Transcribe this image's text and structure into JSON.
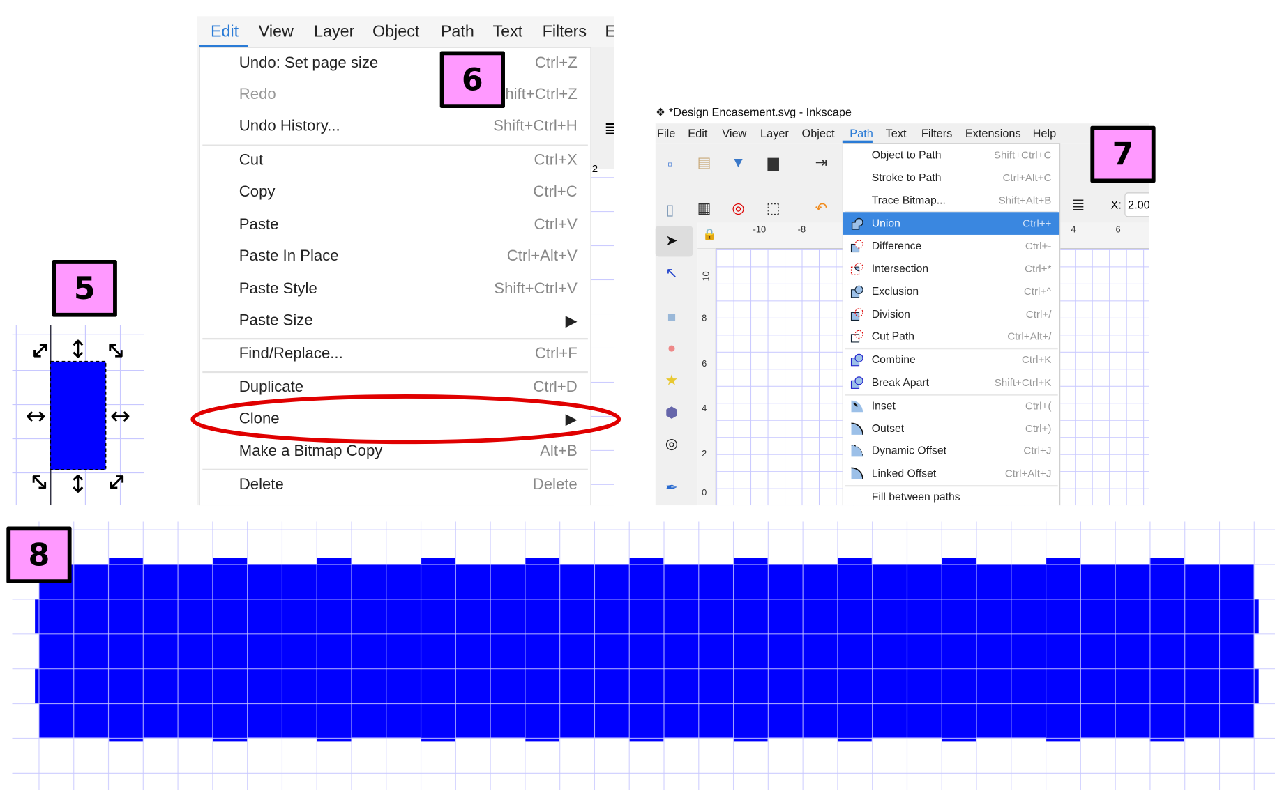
{
  "labels": {
    "step5": "5",
    "step6": "6",
    "step7": "7",
    "step8": "8"
  },
  "colors": {
    "label_fill": "#ff99ff",
    "shape_fill": "#0000ff",
    "grid": "#c8c8ff",
    "highlight": "#3a87e0",
    "annotation_ellipse": "#e00000"
  },
  "edit_menu": {
    "menubar": [
      "Edit",
      "View",
      "Layer",
      "Object",
      "Path",
      "Text",
      "Filters",
      "E"
    ],
    "active": "Edit",
    "items": [
      {
        "label": "Undo: Set page size",
        "shortcut": "Ctrl+Z"
      },
      {
        "label": "Redo",
        "shortcut": "Shift+Ctrl+Z",
        "disabled": true
      },
      {
        "label": "Undo History...",
        "shortcut": "Shift+Ctrl+H"
      },
      {
        "label": "Cut",
        "shortcut": "Ctrl+X"
      },
      {
        "label": "Copy",
        "shortcut": "Ctrl+C"
      },
      {
        "label": "Paste",
        "shortcut": "Ctrl+V"
      },
      {
        "label": "Paste In Place",
        "shortcut": "Ctrl+Alt+V"
      },
      {
        "label": "Paste Style",
        "shortcut": "Shift+Ctrl+V"
      },
      {
        "label": "Paste Size",
        "shortcut": "▶"
      },
      {
        "label": "Find/Replace...",
        "shortcut": "Ctrl+F"
      },
      {
        "label": "Duplicate",
        "shortcut": "Ctrl+D"
      },
      {
        "label": "Clone",
        "shortcut": "▶",
        "circled": true
      },
      {
        "label": "Make a Bitmap Copy",
        "shortcut": "Alt+B"
      },
      {
        "label": "Delete",
        "shortcut": "Delete"
      }
    ],
    "side_ruler_label": "2"
  },
  "inkscape": {
    "title": "*Design Encasement.svg - Inkscape",
    "menubar": [
      "File",
      "Edit",
      "View",
      "Layer",
      "Object",
      "Path",
      "Text",
      "Filters",
      "Extensions",
      "Help"
    ],
    "active": "Path",
    "x_label": "X:",
    "x_value": "2.000",
    "hruler_labels": [
      "-10",
      "-8",
      "4",
      "6"
    ],
    "vruler_labels": [
      "10",
      "8",
      "6",
      "4",
      "2",
      "0"
    ],
    "path_menu": [
      {
        "label": "Object to Path",
        "shortcut": "Shift+Ctrl+C",
        "icon": "none"
      },
      {
        "label": "Stroke to Path",
        "shortcut": "Ctrl+Alt+C",
        "icon": "none"
      },
      {
        "label": "Trace Bitmap...",
        "shortcut": "Shift+Alt+B",
        "icon": "none"
      },
      {
        "label": "Union",
        "shortcut": "Ctrl++",
        "icon": "union-icon",
        "highlighted": true
      },
      {
        "label": "Difference",
        "shortcut": "Ctrl+-",
        "icon": "difference-icon"
      },
      {
        "label": "Intersection",
        "shortcut": "Ctrl+*",
        "icon": "intersection-icon"
      },
      {
        "label": "Exclusion",
        "shortcut": "Ctrl+^",
        "icon": "exclusion-icon"
      },
      {
        "label": "Division",
        "shortcut": "Ctrl+/",
        "icon": "division-icon"
      },
      {
        "label": "Cut Path",
        "shortcut": "Ctrl+Alt+/",
        "icon": "cut-path-icon"
      },
      {
        "label": "Combine",
        "shortcut": "Ctrl+K",
        "icon": "combine-icon"
      },
      {
        "label": "Break Apart",
        "shortcut": "Shift+Ctrl+K",
        "icon": "break-apart-icon"
      },
      {
        "label": "Inset",
        "shortcut": "Ctrl+(",
        "icon": "inset-icon"
      },
      {
        "label": "Outset",
        "shortcut": "Ctrl+)",
        "icon": "outset-icon"
      },
      {
        "label": "Dynamic Offset",
        "shortcut": "Ctrl+J",
        "icon": "dynamic-offset-icon"
      },
      {
        "label": "Linked Offset",
        "shortcut": "Ctrl+Alt+J",
        "icon": "linked-offset-icon"
      },
      {
        "label": "Fill between paths",
        "shortcut": "",
        "icon": "none"
      }
    ]
  }
}
